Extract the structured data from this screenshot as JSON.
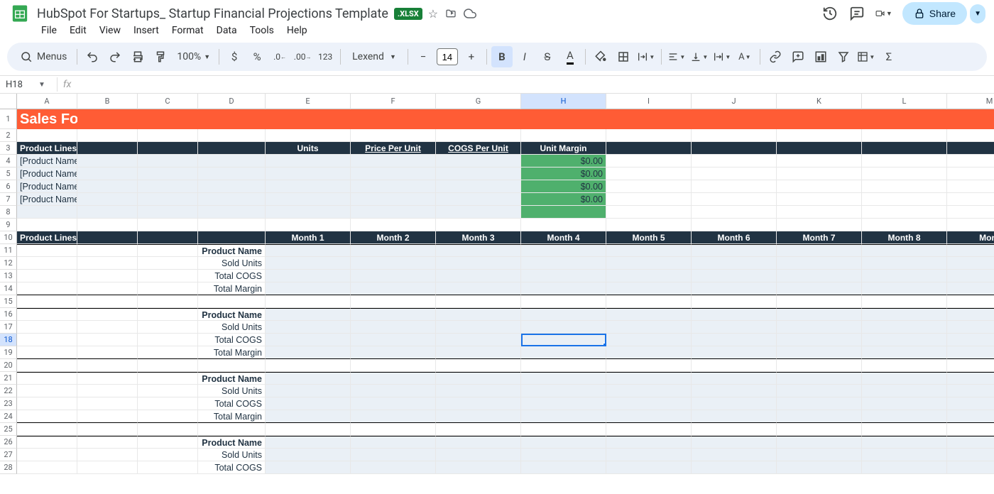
{
  "doc": {
    "title": "HubSpot For Startups_ Startup Financial Projections Template",
    "badge": ".XLSX"
  },
  "menus": [
    "File",
    "Edit",
    "View",
    "Insert",
    "Format",
    "Data",
    "Tools",
    "Help"
  ],
  "toolbar": {
    "menus_label": "Menus",
    "zoom": "100%",
    "font": "Lexend",
    "font_size": "14",
    "share_label": "Share"
  },
  "formula": {
    "cell_ref": "H18",
    "value": ""
  },
  "columns": [
    "A",
    "B",
    "C",
    "D",
    "E",
    "F",
    "G",
    "H",
    "I",
    "J",
    "K",
    "L",
    "M"
  ],
  "sheet": {
    "title": "Sales Forecasts",
    "header1": {
      "product_lines": "Product Lines",
      "units": "Units",
      "price_per_unit": "Price Per Unit",
      "cogs_per_unit": "COGS Per Unit",
      "unit_margin": "Unit Margin"
    },
    "products": [
      {
        "name": "[Product Name]",
        "margin": "$0.00"
      },
      {
        "name": "[Product Name]",
        "margin": "$0.00"
      },
      {
        "name": "[Product Name]",
        "margin": "$0.00"
      },
      {
        "name": "[Product Name]",
        "margin": "$0.00"
      }
    ],
    "header2": {
      "product_lines": "Product Lines",
      "months": [
        "Month 1",
        "Month 2",
        "Month 3",
        "Month 4",
        "Month 5",
        "Month 6",
        "Month 7",
        "Month 8",
        "Mont"
      ]
    },
    "group_labels": {
      "product_name": "Product Name",
      "sold_units": "Sold Units",
      "total_cogs": "Total COGS",
      "total_margin": "Total Margin"
    }
  }
}
